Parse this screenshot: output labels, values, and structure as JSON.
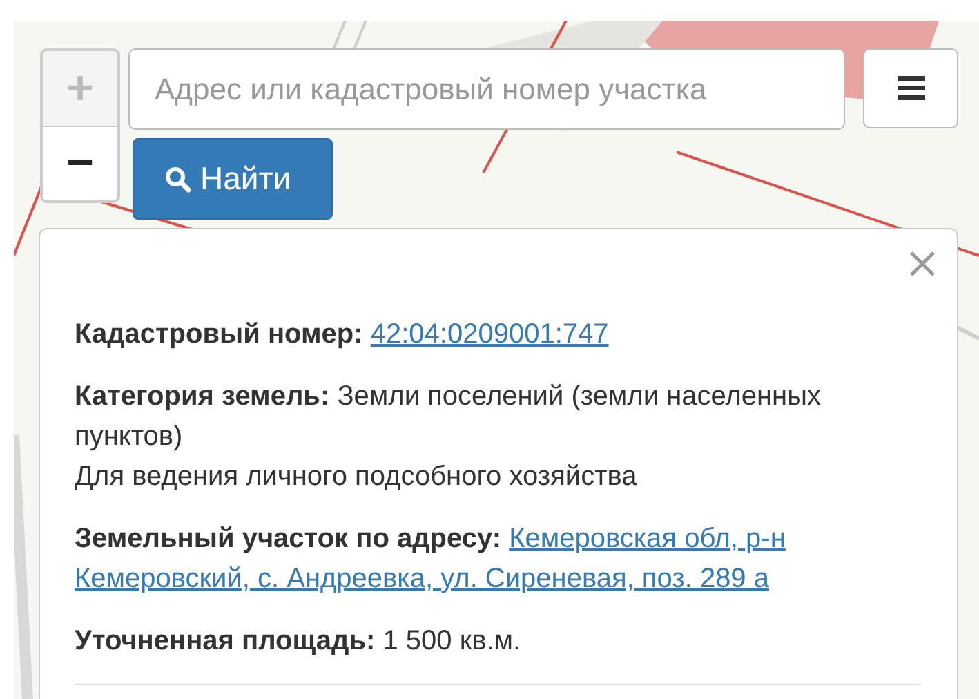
{
  "zoom": {
    "zoom_in": {
      "label": "+",
      "disabled": true
    },
    "zoom_out": {
      "label": "−",
      "disabled": false
    }
  },
  "search": {
    "placeholder": "Адрес или кадастровый номер участка"
  },
  "find_button": {
    "label": "Найти"
  },
  "popup": {
    "rows": [
      {
        "label": "Кадастровый номер:",
        "value": "42:04:0209001:747",
        "kind": "link"
      },
      {
        "label": "Категория земель:",
        "value": "Земли поселений (земли населенных пунктов)",
        "kind": "text",
        "note": "Для ведения личного подсобного хозяйства"
      },
      {
        "label": "Земельный участок по адресу:",
        "value_lines": [
          "Кемеровская обл, р-н",
          "Кемеровский, с. Андреевка, ул. Сиреневая, поз. 289 а"
        ],
        "kind": "address"
      },
      {
        "label": "Уточненная площадь:",
        "value": "1 500 кв.м.",
        "kind": "text"
      }
    ]
  }
}
